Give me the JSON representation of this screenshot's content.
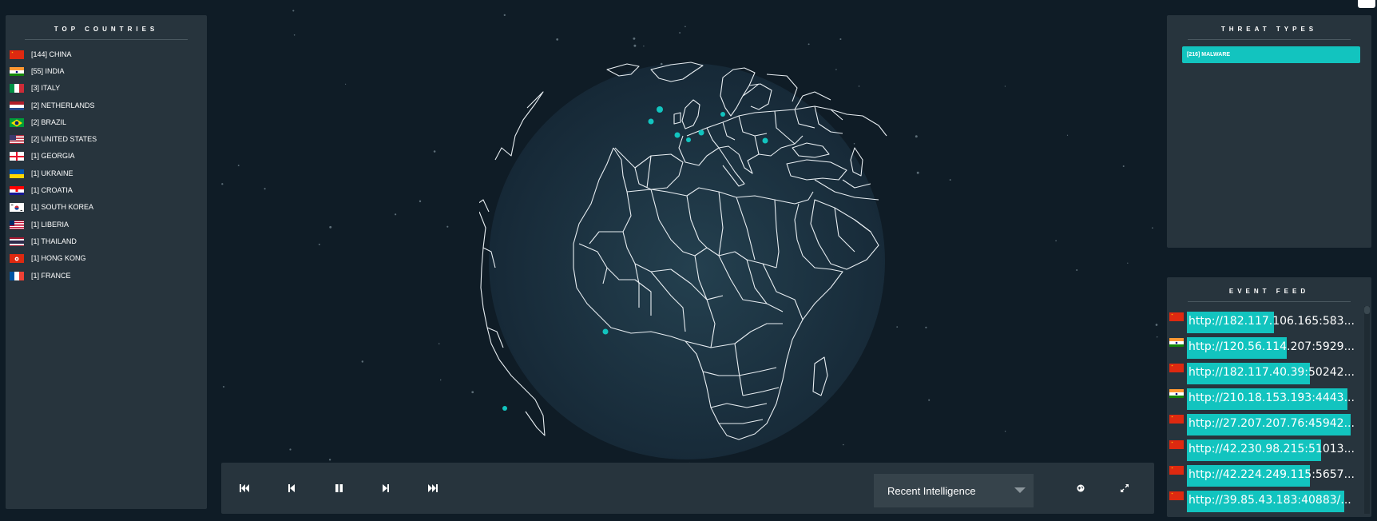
{
  "top_countries": {
    "title": "TOP COUNTRIES",
    "items": [
      {
        "label": "[144] CHINA",
        "flag": "china-flag-icon"
      },
      {
        "label": "[55] INDIA",
        "flag": "india-flag-icon"
      },
      {
        "label": "[3] ITALY",
        "flag": "italy-flag-icon"
      },
      {
        "label": "[2] NETHERLANDS",
        "flag": "netherlands-flag-icon"
      },
      {
        "label": "[2] BRAZIL",
        "flag": "brazil-flag-icon"
      },
      {
        "label": "[2] UNITED STATES",
        "flag": "united-states-flag-icon"
      },
      {
        "label": "[1] GEORGIA",
        "flag": "georgia-flag-icon"
      },
      {
        "label": "[1] UKRAINE",
        "flag": "ukraine-flag-icon"
      },
      {
        "label": "[1] CROATIA",
        "flag": "croatia-flag-icon"
      },
      {
        "label": "[1] SOUTH KOREA",
        "flag": "south-korea-flag-icon"
      },
      {
        "label": "[1] LIBERIA",
        "flag": "liberia-flag-icon"
      },
      {
        "label": "[1] THAILAND",
        "flag": "thailand-flag-icon"
      },
      {
        "label": "[1] HONG KONG",
        "flag": "hong-kong-flag-icon"
      },
      {
        "label": "[1] FRANCE",
        "flag": "france-flag-icon"
      }
    ]
  },
  "threat_types": {
    "title": "THREAT TYPES",
    "items": [
      {
        "label": "[216] MALWARE"
      }
    ]
  },
  "event_feed": {
    "title": "EVENT FEED",
    "items": [
      {
        "url": "http://182.117.106.165:583...",
        "flag": "china-flag-icon",
        "bar": 0.53
      },
      {
        "url": "http://120.56.114.207:5929...",
        "flag": "india-flag-icon",
        "bar": 0.61
      },
      {
        "url": "http://182.117.40.39:50242...",
        "flag": "china-flag-icon",
        "bar": 0.75
      },
      {
        "url": "http://210.18.153.193:4443...",
        "flag": "india-flag-icon",
        "bar": 0.98
      },
      {
        "url": "http://27.207.207.76:45942...",
        "flag": "china-flag-icon",
        "bar": 1.0
      },
      {
        "url": "http://42.230.98.215:51013...",
        "flag": "china-flag-icon",
        "bar": 0.82
      },
      {
        "url": "http://42.224.249.115:5657...",
        "flag": "china-flag-icon",
        "bar": 0.75
      },
      {
        "url": "http://39.85.43.183:40883/...",
        "flag": "china-flag-icon",
        "bar": 0.96
      }
    ]
  },
  "controls": {
    "view_select": "Recent Intelligence",
    "buttons": [
      "skip-to-start-icon",
      "step-back-icon",
      "pause-icon",
      "step-forward-icon",
      "skip-to-end-icon"
    ]
  },
  "colors": {
    "accent": "#12c4bf",
    "background": "#0f1c26",
    "panel": "#27343d"
  }
}
